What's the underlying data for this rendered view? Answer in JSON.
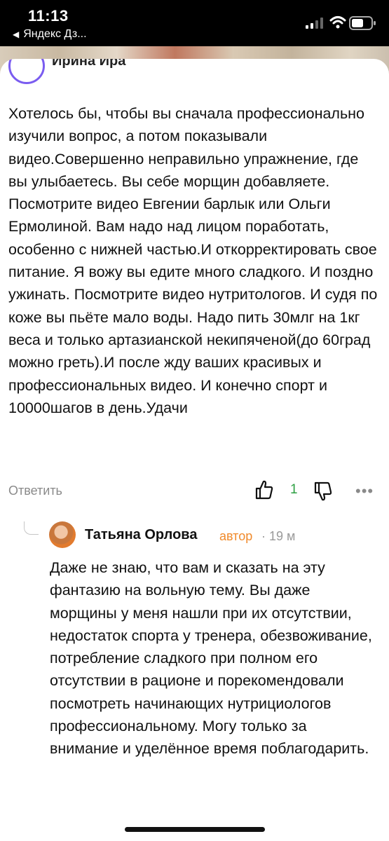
{
  "status_bar": {
    "time": "11:13",
    "back_app": "Яндекс Дз...",
    "icons": [
      "signal-icon",
      "wifi-icon",
      "battery-icon"
    ]
  },
  "comment": {
    "author_partial": "Ирина Ира",
    "text": "Хотелось бы, чтобы вы сначала профессионально изучили вопрос, а потом показывали видео.Совершенно неправильно упражнение, где вы улыбаетесь. Вы себе морщин добавляете. Посмотрите видео Евгении барлык или Ольги Ермолиной. Вам надо над лицом поработать, особенно с нижней частью.И откорректировать свое питание. Я вожу вы едите много сладкого. И поздно ужинать. Посмотрите видео нутритологов. И судя по коже вы пьёте мало воды. Надо пить 30млг на 1кг веса и только артазианской некипяченой(до 60град можно греть).И после жду ваших красивых и профессиональных видео. И конечно спорт и 10000шагов в день.Удачи",
    "reply_label": "Ответить",
    "like_count": "1",
    "more": "•••"
  },
  "reply": {
    "author": "Татьяна Орлова",
    "badge": "автор",
    "time": "· 19 м",
    "text": "Даже не знаю, что вам и сказать на эту фантазию на вольную тему. Вы даже морщины у меня нашли при их отсутствии, недостаток спорта у тренера, обезвоживание, потребление сладкого при полном его отсутствии в рационе и порекомендовали посмотреть начинающих нутрициологов профессиональному. Могу только за внимание и уделённое время поблагодарить."
  },
  "colors": {
    "like_count": "#2ea043",
    "author_badge": "#f08a2b",
    "muted": "#8a8a8a"
  }
}
